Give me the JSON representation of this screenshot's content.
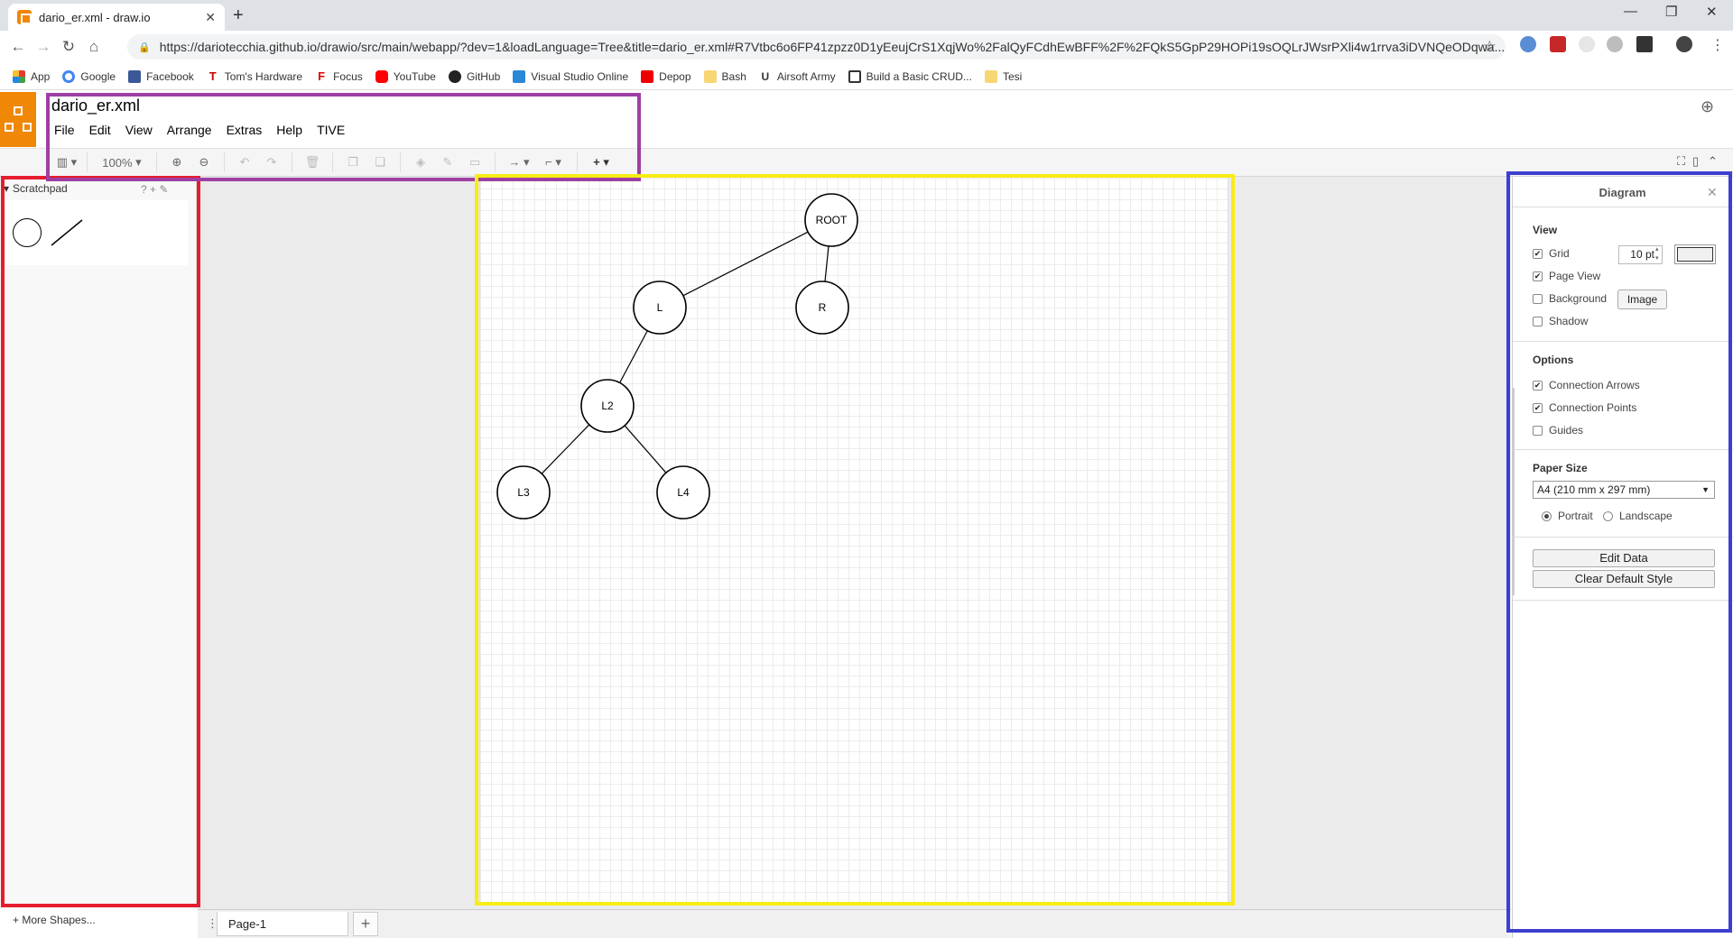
{
  "browser": {
    "tab_title": "dario_er.xml - draw.io",
    "url": "https://dariotecchia.github.io/drawio/src/main/webapp/?dev=1&loadLanguage=Tree&title=dario_er.xml#R7Vtbc6o6FP41zpzz0D1yEeujCrS1XqjWo%2FalQyFCdhEwBFF%2F%2FQkS5GpP29HOPi19sOQLrJWsrPXli4w1rrva3iDVNQeODqwa...",
    "bookmarks": [
      "App",
      "Google",
      "Facebook",
      "Tom's Hardware",
      "Focus",
      "YouTube",
      "GitHub",
      "Visual Studio Online",
      "Depop",
      "Bash",
      "Airsoft Army",
      "Build a Basic CRUD...",
      "Tesi"
    ]
  },
  "app": {
    "file_title": "dario_er.xml",
    "menu": [
      "File",
      "Edit",
      "View",
      "Arrange",
      "Extras",
      "Help",
      "TIVE"
    ],
    "zoom": "100%"
  },
  "left_panel": {
    "scratchpad_label": "Scratchpad",
    "scratchpad_tools": "? + ✎",
    "more_shapes": "More Shapes..."
  },
  "diagram": {
    "nodes": [
      {
        "id": "root",
        "label": "ROOT"
      },
      {
        "id": "l",
        "label": "L"
      },
      {
        "id": "r",
        "label": "R"
      },
      {
        "id": "l2",
        "label": "L2"
      },
      {
        "id": "l3",
        "label": "L3"
      },
      {
        "id": "l4",
        "label": "L4"
      }
    ],
    "edges": [
      [
        "root",
        "l"
      ],
      [
        "root",
        "r"
      ],
      [
        "l",
        "l2"
      ],
      [
        "l2",
        "l3"
      ],
      [
        "l2",
        "l4"
      ]
    ]
  },
  "pages": {
    "current": "Page-1"
  },
  "right_panel": {
    "title": "Diagram",
    "view_label": "View",
    "grid_label": "Grid",
    "grid_size": "10 pt",
    "page_view_label": "Page View",
    "background_label": "Background",
    "image_button": "Image",
    "shadow_label": "Shadow",
    "options_label": "Options",
    "connection_arrows_label": "Connection Arrows",
    "connection_points_label": "Connection Points",
    "guides_label": "Guides",
    "paper_size_label": "Paper Size",
    "paper_size_value": "A4 (210 mm x 297 mm)",
    "portrait_label": "Portrait",
    "landscape_label": "Landscape",
    "edit_data_button": "Edit Data",
    "clear_default_style_button": "Clear Default Style",
    "checked": {
      "grid": true,
      "page_view": true,
      "background": false,
      "shadow": false,
      "connection_arrows": true,
      "connection_points": true,
      "guides": false
    },
    "orientation": "portrait"
  },
  "colors": {
    "brand": "#f08705",
    "highlight_red": "#e51d2e",
    "highlight_purple": "#9e3fa3",
    "highlight_yellow": "#f7ec14",
    "highlight_blue": "#3e3fce"
  }
}
